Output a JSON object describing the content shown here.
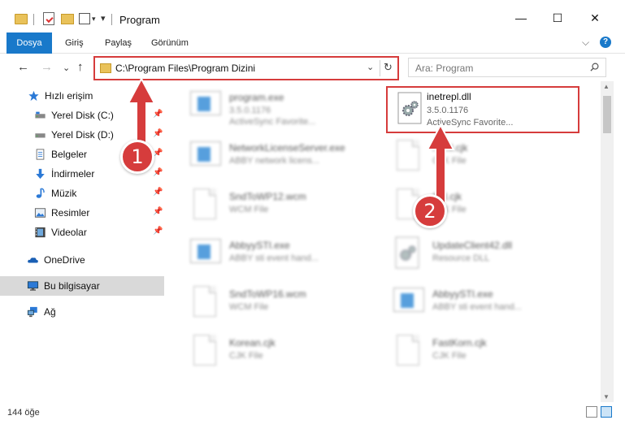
{
  "window": {
    "title": "Program",
    "minimize_glyph": "—",
    "maximize_glyph": "☐",
    "close_glyph": "✕"
  },
  "quick_access_toolbar": {
    "separator": "|",
    "dropdown_glyph": "▾"
  },
  "ribbon": {
    "tabs": [
      "Dosya",
      "Giriş",
      "Paylaş",
      "Görünüm"
    ],
    "collapse_glyph": "⌵",
    "help_label": "?"
  },
  "navigation": {
    "back_glyph": "←",
    "forward_glyph": "→",
    "up_glyph": "↑",
    "recent_glyph": "⌄",
    "address": "C:\\Program Files\\Program Dizini",
    "address_dropdown_glyph": "⌄",
    "refresh_glyph": "↻",
    "search_placeholder": "Ara: Program"
  },
  "sidebar": {
    "items": [
      {
        "label": "Hızlı erişim",
        "icon": "star-icon",
        "color": "#2b79d6"
      },
      {
        "label": "Yerel Disk (C:)",
        "icon": "drive-icon",
        "pinned": true
      },
      {
        "label": "Yerel Disk (D:)",
        "icon": "drive-icon",
        "pinned": true
      },
      {
        "label": "Belgeler",
        "icon": "documents-icon",
        "pinned": true
      },
      {
        "label": "İndirmeler",
        "icon": "download-icon",
        "pinned": true
      },
      {
        "label": "Müzik",
        "icon": "music-icon",
        "pinned": true
      },
      {
        "label": "Resimler",
        "icon": "pictures-icon",
        "pinned": true
      },
      {
        "label": "Videolar",
        "icon": "video-icon",
        "pinned": true
      },
      {
        "label": "OneDrive",
        "icon": "cloud-icon"
      },
      {
        "label": "Bu bilgisayar",
        "icon": "computer-icon",
        "selected": true
      },
      {
        "label": "Ağ",
        "icon": "network-icon"
      }
    ],
    "pin_glyph": "📌"
  },
  "files": [
    {
      "name": "program.exe",
      "line1": "3.5.0.1176",
      "line2": "ActiveSync Favorite...",
      "icon": "app-icon",
      "blurred": true
    },
    {
      "name": "inetrepl.dll",
      "line1": "3.5.0.1176",
      "line2": "ActiveSync Favorite...",
      "icon": "gear-file-icon",
      "highlighted": true
    },
    {
      "name": "NetworkLicenseServer.exe",
      "line1": "ABBY network licens...",
      "line2": "",
      "icon": "app-icon",
      "blurred": true
    },
    {
      "name": "Nrml.cjk",
      "line1": "CJK File",
      "line2": "",
      "icon": "file-icon",
      "blurred": true
    },
    {
      "name": "SndToWP12.wcm",
      "line1": "WCM File",
      "line2": "",
      "icon": "file-icon",
      "blurred": true
    },
    {
      "name": "Std.cjk",
      "line1": "CJK File",
      "line2": "",
      "icon": "file-icon",
      "blurred": true
    },
    {
      "name": "AbbyySTI.exe",
      "line1": "ABBY sti event hand...",
      "line2": "",
      "icon": "app-icon",
      "blurred": true
    },
    {
      "name": "UpdateClient42.dll",
      "line1": "Resource DLL",
      "line2": "",
      "icon": "gear-file-icon",
      "blurred": true
    },
    {
      "name": "SndToWP16.wcm",
      "line1": "WCM File",
      "line2": "",
      "icon": "file-icon",
      "blurred": true
    },
    {
      "name": "AbbyySTI.exe",
      "line1": "ABBY sti event hand...",
      "line2": "",
      "icon": "app-icon",
      "blurred": true
    },
    {
      "name": "Korean.cjk",
      "line1": "CJK File",
      "line2": "",
      "icon": "file-icon",
      "blurred": true
    },
    {
      "name": "FastKorn.cjk",
      "line1": "CJK File",
      "line2": "",
      "icon": "file-icon",
      "blurred": true
    }
  ],
  "scrollbar": {
    "up_glyph": "▲",
    "down_glyph": "▼"
  },
  "status": {
    "item_count": "144 öğe"
  },
  "annotations": [
    {
      "number": "1",
      "color": "#d63c3c"
    },
    {
      "number": "2",
      "color": "#d63c3c"
    }
  ],
  "colors": {
    "accent": "#1979ca",
    "highlight": "#d63c3c",
    "selected": "#d9d9d9"
  }
}
